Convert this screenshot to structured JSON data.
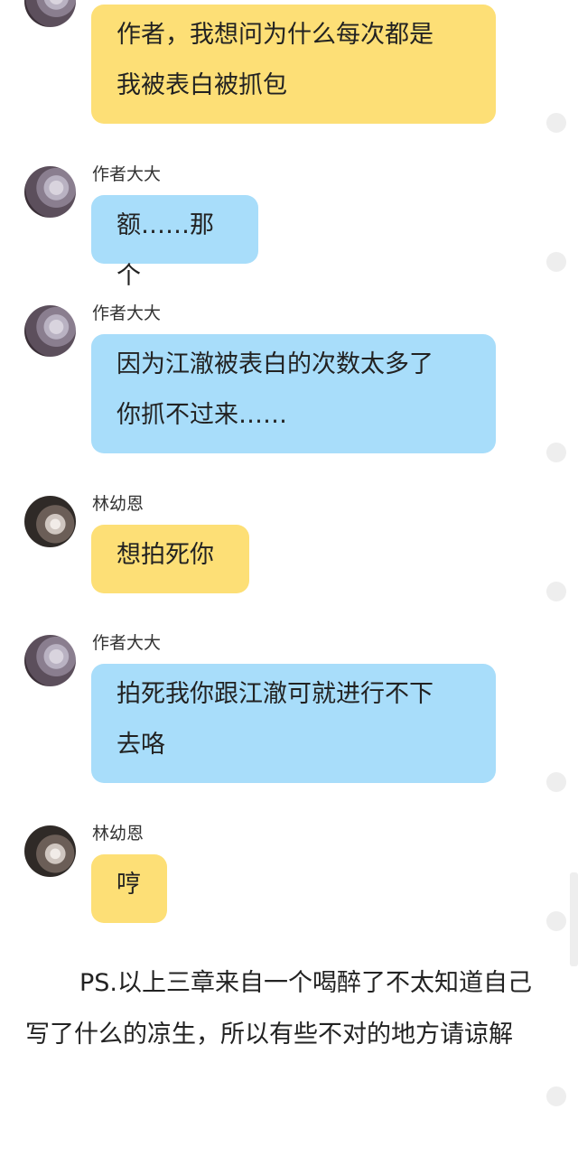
{
  "messages": [
    {
      "sender_name": "",
      "avatar": "avatar-author",
      "text": "作者，我想问为什么每次都是\n我被表白被抓包",
      "bubble_color": "#fddf76"
    },
    {
      "sender_name": "作者大大",
      "avatar": "avatar-author",
      "text": "额……那个",
      "bubble_color": "#a8ddfa"
    },
    {
      "sender_name": "作者大大",
      "avatar": "avatar-author",
      "text": "因为江澈被表白的次数太多了\n你抓不过来……",
      "bubble_color": "#a8ddfa"
    },
    {
      "sender_name": "林幼恩",
      "avatar": "avatar-lin",
      "text": "想拍死你",
      "bubble_color": "#fddf76"
    },
    {
      "sender_name": "作者大大",
      "avatar": "avatar-author",
      "text": "拍死我你跟江澈可就进行不下\n去咯",
      "bubble_color": "#a8ddfa"
    },
    {
      "sender_name": "林幼恩",
      "avatar": "avatar-lin",
      "text": "哼",
      "bubble_color": "#fddf76"
    }
  ],
  "ps_note": "PS.以上三章来自一个喝醉了不太知道自己写了什么的凉生，所以有些不对的地方请谅解"
}
